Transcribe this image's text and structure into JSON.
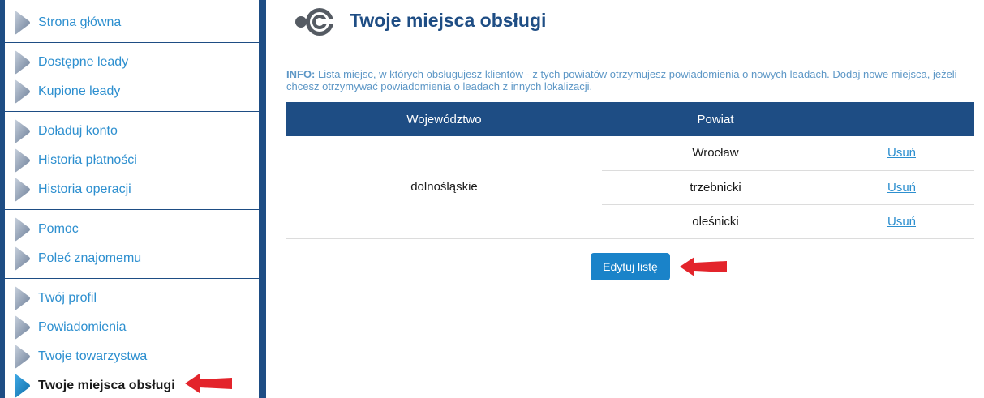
{
  "sidebar": {
    "groups": [
      {
        "items": [
          {
            "label": "Strona główna"
          }
        ]
      },
      {
        "items": [
          {
            "label": "Dostępne leady"
          },
          {
            "label": "Kupione leady"
          }
        ]
      },
      {
        "items": [
          {
            "label": "Doładuj konto"
          },
          {
            "label": "Historia płatności"
          },
          {
            "label": "Historia operacji"
          }
        ]
      },
      {
        "items": [
          {
            "label": "Pomoc"
          },
          {
            "label": "Poleć znajomemu"
          }
        ]
      },
      {
        "items": [
          {
            "label": "Twój profil"
          },
          {
            "label": "Powiadomienia"
          },
          {
            "label": "Twoje towarzystwa"
          },
          {
            "label": "Twoje miejsca obsługi",
            "active": true
          }
        ]
      }
    ],
    "icon": "triangle-play-icon",
    "colors": {
      "frame": "#1e4d84",
      "link": "#2d8fcf",
      "active_icon": "#1a83c9"
    }
  },
  "header": {
    "title": "Twoje miejsca obsługi",
    "logo_icon": "locations-logo-icon"
  },
  "info": {
    "label": "INFO:",
    "text": " Lista miejsc, w których obsługujesz klientów - z tych powiatów otrzymujesz powiadomienia o nowych leadach. Dodaj nowe miejsca, jeżeli chcesz otrzymywać powiadomienia o leadach z innych lokalizacji."
  },
  "table": {
    "columns": [
      "Województwo",
      "Powiat",
      ""
    ],
    "voivodeship": "dolnośląskie",
    "rows": [
      {
        "powiat": "Wrocław",
        "action": "Usuń"
      },
      {
        "powiat": "trzebnicki",
        "action": "Usuń"
      },
      {
        "powiat": "oleśnicki",
        "action": "Usuń"
      }
    ]
  },
  "edit_button": {
    "label": "Edytuj listę"
  },
  "annotations": {
    "arrow_color": "#e3242b",
    "arrow_icon": "red-arrow-icon"
  }
}
